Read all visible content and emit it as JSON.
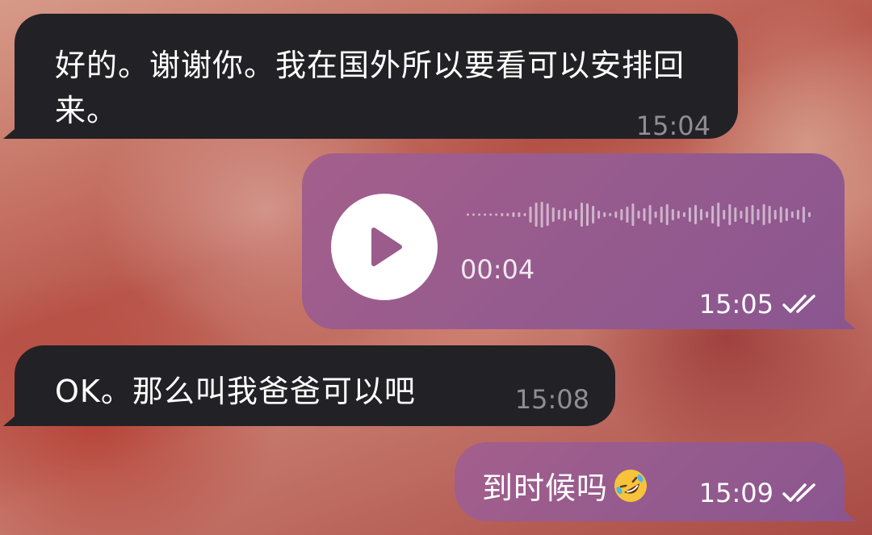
{
  "messages": [
    {
      "type": "text",
      "direction": "incoming",
      "text": "好的。谢谢你。我在国外所以要看可以安排回来。",
      "time": "15:04"
    },
    {
      "type": "voice",
      "direction": "outgoing",
      "duration": "00:04",
      "time": "15:05",
      "status_icon": "double-check-icon"
    },
    {
      "type": "text",
      "direction": "incoming",
      "text": "OK。那么叫我爸爸可以吧",
      "time": "15:08"
    },
    {
      "type": "text",
      "direction": "outgoing",
      "text": "到时候吗",
      "emoji": "rolling-on-floor-laughing-emoji",
      "time": "15:09",
      "status_icon": "double-check-icon"
    }
  ],
  "colors": {
    "incoming_bubble": "#222226",
    "outgoing_bubble": "#9a5b8d",
    "timestamp_incoming": "#8e8e93"
  }
}
